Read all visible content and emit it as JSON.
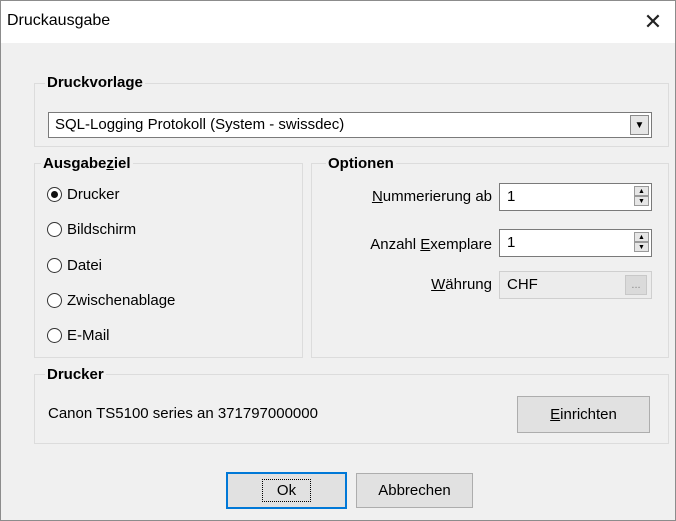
{
  "window": {
    "title": "Druckausgabe",
    "close_glyph": "✕"
  },
  "druckvorlage": {
    "label": "Druckvorlage",
    "selected": "SQL-Logging Protokoll (System - swissdec)"
  },
  "ausgabeziel": {
    "label_pre": "Ausgabe",
    "label_ul": "z",
    "label_post": "iel",
    "options": [
      {
        "label": "Drucker",
        "checked": true
      },
      {
        "label": "Bildschirm",
        "checked": false
      },
      {
        "label": "Datei",
        "checked": false
      },
      {
        "label": "Zwischenablage",
        "checked": false
      },
      {
        "label": "E-Mail",
        "checked": false
      }
    ]
  },
  "optionen": {
    "label": "Optionen",
    "nummerierung": {
      "label_ul": "N",
      "label_rest": "ummerierung ab",
      "value": "1"
    },
    "exemplare": {
      "label_pre": "Anzahl ",
      "label_ul": "E",
      "label_rest": "xemplare",
      "value": "1"
    },
    "waehrung": {
      "label_ul": "W",
      "label_rest": "ährung",
      "value": "CHF",
      "button": "..."
    }
  },
  "drucker": {
    "label": "Drucker",
    "name": "Canon TS5100 series an 371797000000",
    "setup_ul": "E",
    "setup_rest": "inrichten"
  },
  "buttons": {
    "ok": "Ok",
    "cancel": "Abbrechen"
  }
}
